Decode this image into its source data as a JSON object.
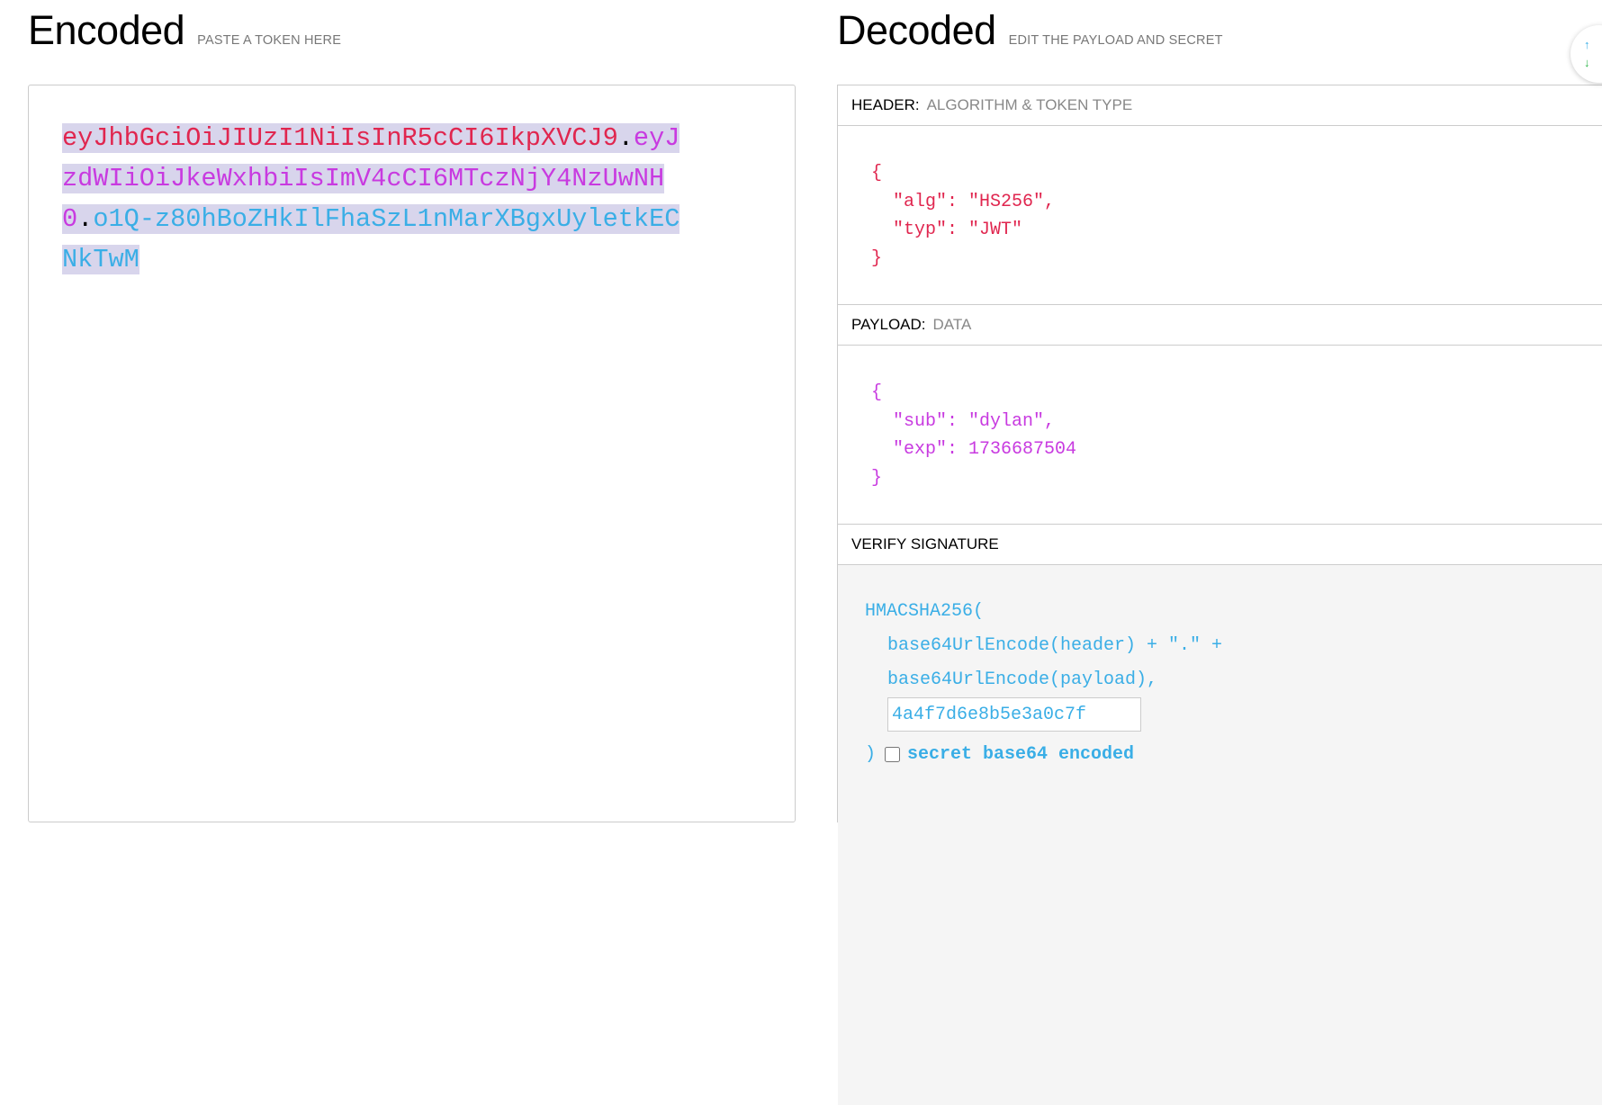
{
  "encoded": {
    "title": "Encoded",
    "subtitle": "PASTE A TOKEN HERE",
    "token": {
      "header": "eyJhbGciOiJIUzI1NiIsInR5cCI6IkpXVCJ9",
      "payload": "eyJzdWIiOiJkeWxhbiIsImV4cCI6MTczNjY4NzUwNH0",
      "signature": "o1Q-z80hBoZHkIlFhaSzL1nMarXBgxUyletkECNkTwM",
      "dot": "."
    }
  },
  "decoded": {
    "title": "Decoded",
    "subtitle": "EDIT THE PAYLOAD AND SECRET",
    "header_section": {
      "label": "HEADER:",
      "extra": "ALGORITHM & TOKEN TYPE",
      "json": "{\n  \"alg\": \"HS256\",\n  \"typ\": \"JWT\"\n}"
    },
    "payload_section": {
      "label": "PAYLOAD:",
      "extra": "DATA",
      "json": "{\n  \"sub\": \"dylan\",\n  \"exp\": 1736687504\n}"
    },
    "signature_section": {
      "label": "VERIFY SIGNATURE",
      "fn_open": "HMACSHA256(",
      "line1": "base64UrlEncode(header) + \".\" +",
      "line2": "base64UrlEncode(payload),",
      "secret": "4a4f7d6e8b5e3a0c7f",
      "close": ")",
      "checkbox_label": "secret base64 encoded"
    }
  },
  "fab": {
    "up_icon": "↑",
    "down_icon": "↓"
  },
  "colors": {
    "header": "#e0264f",
    "payload": "#c83ae0",
    "signature": "#3aaee6",
    "selection": "#d8d5ec"
  }
}
